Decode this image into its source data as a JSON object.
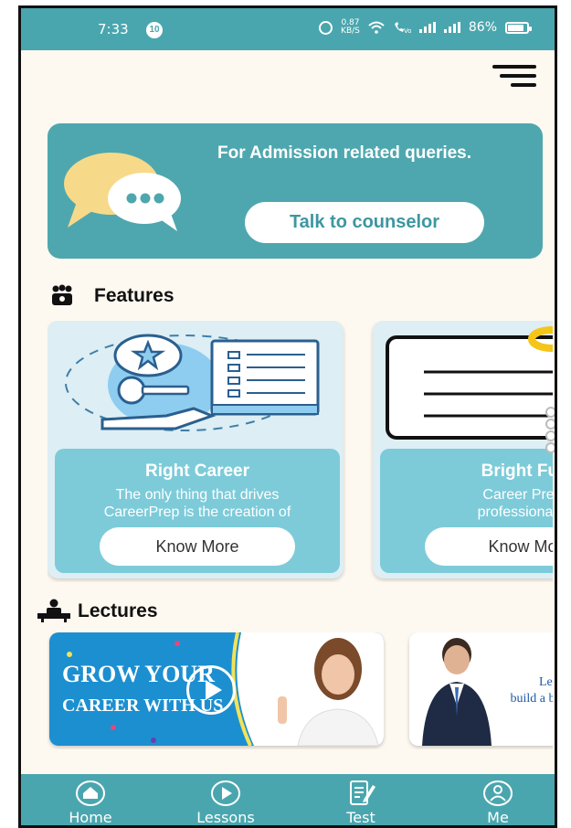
{
  "status_bar": {
    "time": "7:33",
    "notification_count": "10",
    "network_speed_value": "0.87",
    "network_speed_unit": "KB/S",
    "battery_percent": "86%",
    "battery_level": 0.86
  },
  "banner": {
    "text": "For Admission related queries.",
    "button_label": "Talk to counselor"
  },
  "features": {
    "title": "Features",
    "cards": [
      {
        "title": "Right Career",
        "description": "The only thing that drives\nCareerPrep is the creation of",
        "button_label": "Know More"
      },
      {
        "title": "Bright Fut",
        "description": "Career Prep\nprofessional c",
        "button_label": "Know Mo"
      }
    ]
  },
  "lectures": {
    "title": "Lectures",
    "items": [
      {
        "line1": "GROW YOUR",
        "line2": "CAREER WITH US"
      },
      {
        "line1": "Learn t",
        "line2": "build a brigh"
      }
    ]
  },
  "bottom_nav": {
    "items": [
      {
        "label": "Home",
        "icon": "home-icon"
      },
      {
        "label": "Lessons",
        "icon": "play-circle-icon"
      },
      {
        "label": "Test",
        "icon": "edit-document-icon"
      },
      {
        "label": "Me",
        "icon": "user-icon"
      }
    ]
  },
  "colors": {
    "teal": "#4aa6ae",
    "card_blue": "#7dcbd9",
    "background": "#fdf8f0"
  }
}
